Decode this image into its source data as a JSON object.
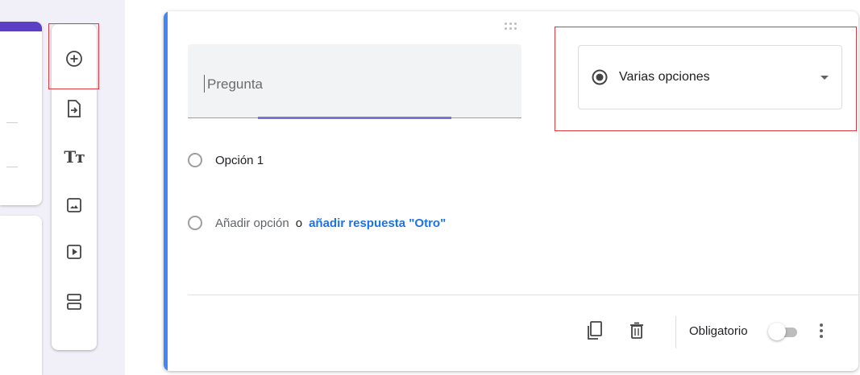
{
  "toolbar": {
    "items": [
      {
        "name": "add-question",
        "icon": "add-circle-icon"
      },
      {
        "name": "import-questions",
        "icon": "import-icon"
      },
      {
        "name": "add-title-description",
        "icon": "title-text-icon",
        "glyph": "Tт"
      },
      {
        "name": "add-image",
        "icon": "image-icon"
      },
      {
        "name": "add-video",
        "icon": "video-icon"
      },
      {
        "name": "add-section",
        "icon": "section-icon"
      }
    ]
  },
  "question": {
    "placeholder": "Pregunta",
    "type_label": "Varias opciones",
    "options": [
      {
        "label": "Opción 1"
      }
    ],
    "add_option_label": "Añadir opción",
    "separator": "o",
    "add_other_label": "añadir respuesta \"Otro\"",
    "required_label": "Obligatorio",
    "required": false
  },
  "colors": {
    "accent": "#4285f4",
    "brand_purple": "#5b3fc4",
    "active_underline": "#7e72d9",
    "link": "#1a73e8",
    "highlight_box": "#e0383e"
  }
}
